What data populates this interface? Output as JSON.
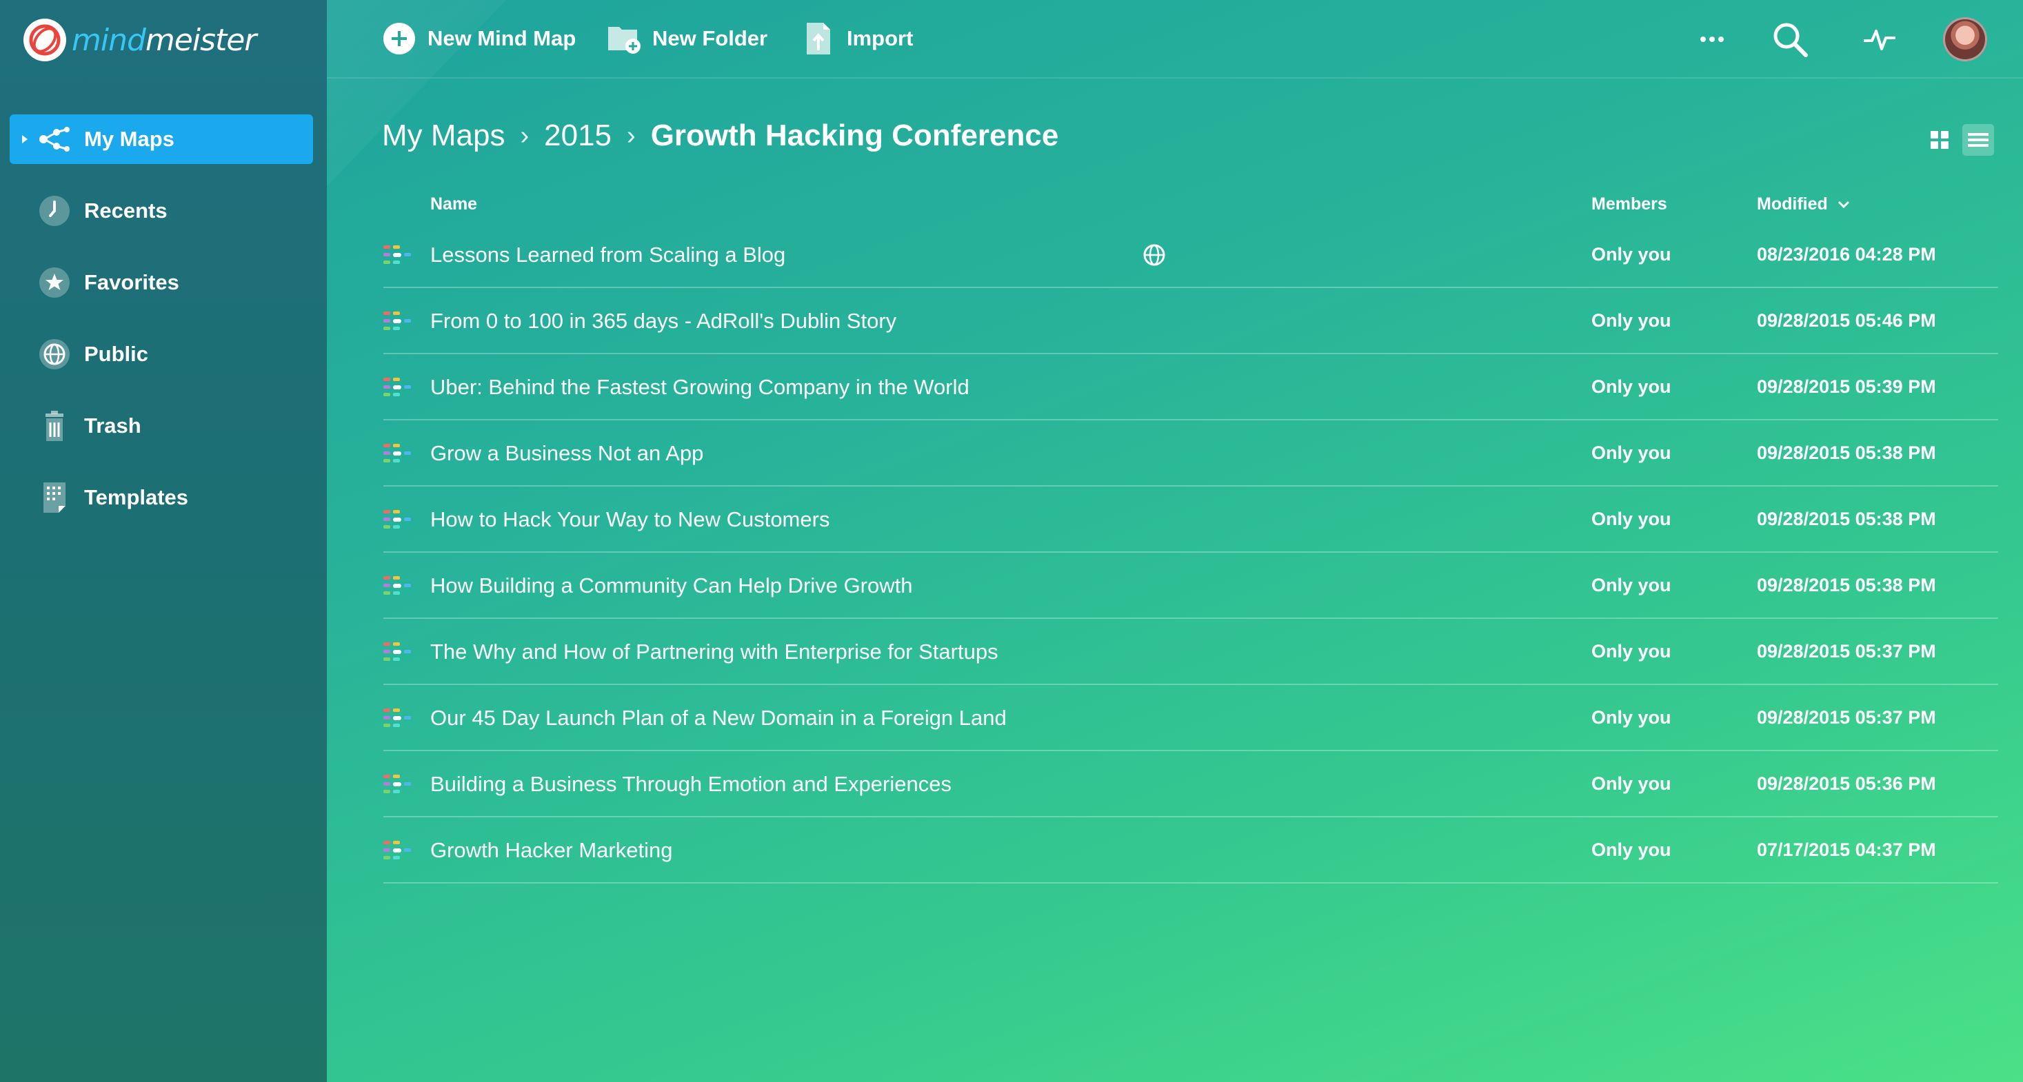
{
  "app": {
    "logo_mind": "mind",
    "logo_meister": "meister"
  },
  "sidebar": {
    "items": [
      {
        "label": "My Maps",
        "icon": "mindmap-icon",
        "active": true
      },
      {
        "label": "Recents",
        "icon": "clock-icon"
      },
      {
        "label": "Favorites",
        "icon": "star-icon"
      },
      {
        "label": "Public",
        "icon": "globe-icon"
      },
      {
        "label": "Trash",
        "icon": "trash-icon"
      },
      {
        "label": "Templates",
        "icon": "templates-icon"
      }
    ]
  },
  "toolbar": {
    "new_map_label": "New Mind Map",
    "new_folder_label": "New Folder",
    "import_label": "Import"
  },
  "breadcrumb": {
    "root": "My Maps",
    "folder": "2015",
    "current": "Growth Hacking Conference"
  },
  "table": {
    "headers": {
      "name": "Name",
      "members": "Members",
      "modified": "Modified"
    },
    "rows": [
      {
        "name": "Lessons Learned from Scaling a Blog",
        "members": "Only you",
        "modified": "08/23/2016 04:28 PM",
        "public": true
      },
      {
        "name": "From 0 to 100 in 365 days - AdRoll's Dublin Story",
        "members": "Only you",
        "modified": "09/28/2015 05:46 PM"
      },
      {
        "name": "Uber: Behind the Fastest Growing Company in the World",
        "members": "Only you",
        "modified": "09/28/2015 05:39 PM"
      },
      {
        "name": "Grow a Business Not an App",
        "members": "Only you",
        "modified": "09/28/2015 05:38 PM"
      },
      {
        "name": "How to Hack Your Way to New Customers",
        "members": "Only you",
        "modified": "09/28/2015 05:38 PM"
      },
      {
        "name": "How Building a Community Can Help Drive Growth",
        "members": "Only you",
        "modified": "09/28/2015 05:38 PM"
      },
      {
        "name": "The Why and How of Partnering with Enterprise for Startups",
        "members": "Only you",
        "modified": "09/28/2015 05:37 PM"
      },
      {
        "name": "Our 45 Day Launch Plan of a New Domain in a Foreign Land",
        "members": "Only you",
        "modified": "09/28/2015 05:37 PM"
      },
      {
        "name": "Building a Business Through Emotion and Experiences",
        "members": "Only you",
        "modified": "09/28/2015 05:36 PM"
      },
      {
        "name": "Growth Hacker Marketing",
        "members": "Only you",
        "modified": "07/17/2015 04:37 PM"
      }
    ]
  },
  "colors": {
    "active_nav": "#1ba9ee",
    "logo_accent": "#38c6f4",
    "logo_red": "#e8453c"
  }
}
